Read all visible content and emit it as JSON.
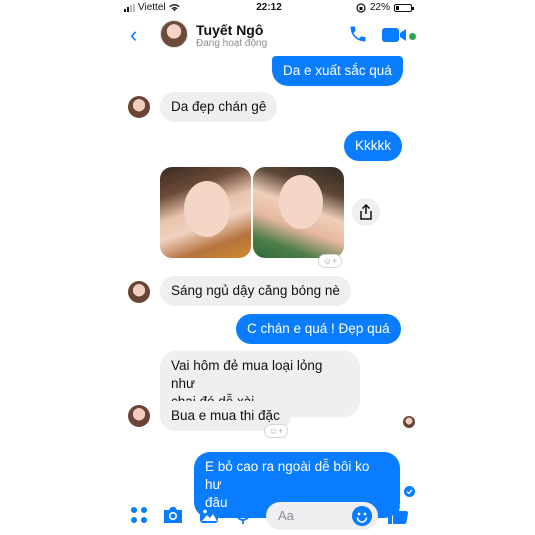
{
  "status_bar": {
    "carrier": "Viettel",
    "time": "22:12",
    "battery": "22%",
    "battery_level": 0.22
  },
  "header": {
    "contact_name": "Tuyết Ngô",
    "contact_status": "Đang hoạt động"
  },
  "messages": [
    {
      "direction": "out",
      "text": "Da e xuất sắc quá"
    },
    {
      "direction": "in",
      "text": "Da đẹp chán gê"
    },
    {
      "direction": "out",
      "text": "Kkkkk"
    },
    {
      "direction": "in",
      "text": "Sáng ngủ dậy căng bóng nè"
    },
    {
      "direction": "out",
      "text": "C chán e quá ! Đẹp quá"
    },
    {
      "direction": "in",
      "text_line1": "Vai hôm đẻ mua loại lỏng như",
      "text_line2": "chai đó dễ xài"
    },
    {
      "direction": "in",
      "text": "Bua e mua thi đặc"
    },
    {
      "direction": "out",
      "text_line1": "E bỏ cao ra ngoài dễ bôi ko hư",
      "text_line2": "đâu"
    }
  ],
  "composer": {
    "placeholder": "Aa"
  },
  "colors": {
    "accent": "#0a7cff",
    "incoming_bubble": "#efeff1",
    "online": "#31a24c"
  },
  "icons": [
    "back-chevron-icon",
    "phone-icon",
    "video-camera-icon",
    "apps-icon",
    "camera-icon",
    "gallery-icon",
    "microphone-icon",
    "emoji-icon",
    "thumbs-up-icon",
    "share-icon",
    "add-reaction-icon"
  ]
}
